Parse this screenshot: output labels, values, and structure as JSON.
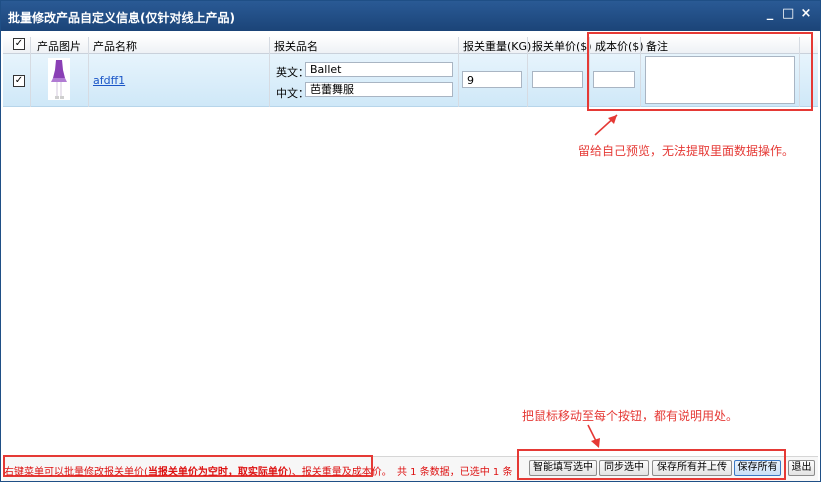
{
  "window": {
    "title": "批量修改产品自定义信息(仅针对线上产品)",
    "controls": [
      "_",
      "□",
      "×"
    ]
  },
  "table": {
    "headers": {
      "image": "产品图片",
      "name": "产品名称",
      "customs_name": "报关品名",
      "weight": "报关重量(KG)",
      "price": "报关单价($)",
      "cost": "成本价($)",
      "remark": "备注"
    },
    "header_checked": true,
    "rows": [
      {
        "checked": true,
        "name": "afdff1",
        "en_label": "英文：",
        "en_value": "Ballet",
        "cn_label": "中文：",
        "cn_value": "芭蕾舞服",
        "weight": "9",
        "price": "",
        "cost": "",
        "remark": ""
      }
    ]
  },
  "annotations": {
    "top_note": "留给自己预览，无法提取里面数据操作。",
    "bottom_note": "把鼠标移动至每个按钮，都有说明用处。"
  },
  "status": {
    "hint_part1": "右键菜单可以批量修改报关单价(",
    "hint_bold": "当报关单价为空时，取实际单价",
    "hint_part2": ")、报关重量及成本价。",
    "count": "共 1 条数据，已选中 1 条"
  },
  "buttons": {
    "smart_fill": "智能填写选中",
    "sync_selected": "同步选中",
    "save_all_upload": "保存所有并上传",
    "save_all": "保存所有",
    "exit": "退出"
  },
  "colors": {
    "title_bar": "#1f4f86",
    "annotation_red": "#e53935",
    "row_highlight": "#d8edfa",
    "link": "#1a56c7"
  }
}
